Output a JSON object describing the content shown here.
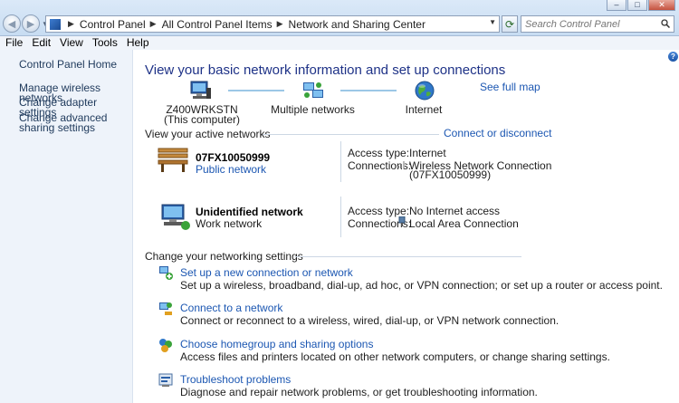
{
  "window": {
    "minimize_glyph": "–",
    "maximize_glyph": "□",
    "close_glyph": "✕"
  },
  "address": {
    "crumbs": [
      "Control Panel",
      "All Control Panel Items",
      "Network and Sharing Center"
    ],
    "search_placeholder": "Search Control Panel"
  },
  "menu": [
    "File",
    "Edit",
    "View",
    "Tools",
    "Help"
  ],
  "sidebar": {
    "home": "Control Panel Home",
    "links": [
      "Manage wireless networks",
      "Change adapter settings",
      "Change advanced sharing settings"
    ]
  },
  "main": {
    "title": "View your basic network information and set up connections",
    "see_full_map": "See full map",
    "map": {
      "computer_name": "Z400WRKSTN",
      "computer_sub": "(This computer)",
      "middle": "Multiple networks",
      "internet": "Internet"
    },
    "active_label": "View your active networks",
    "connect_link": "Connect or disconnect",
    "networks": [
      {
        "name": "07FX10050999",
        "type": "Public network",
        "access_label": "Access type:",
        "access_value": "Internet",
        "conn_label": "Connections:",
        "conn_line1": "Wireless Network Connection",
        "conn_line2": "(07FX10050999)"
      },
      {
        "name": "Unidentified network",
        "type": "Work network",
        "access_label": "Access type:",
        "access_value": "No Internet access",
        "conn_label": "Connections:",
        "conn_line1": "Local Area Connection"
      }
    ],
    "change_label": "Change your networking settings",
    "tasks": [
      {
        "title": "Set up a new connection or network",
        "desc": "Set up a wireless, broadband, dial-up, ad hoc, or VPN connection; or set up a router or access point."
      },
      {
        "title": "Connect to a network",
        "desc": "Connect or reconnect to a wireless, wired, dial-up, or VPN network connection."
      },
      {
        "title": "Choose homegroup and sharing options",
        "desc": "Access files and printers located on other network computers, or change sharing settings."
      },
      {
        "title": "Troubleshoot problems",
        "desc": "Diagnose and repair network problems, or get troubleshooting information."
      }
    ],
    "help_glyph": "?"
  },
  "colors": {
    "link": "#1c57b2",
    "title": "#1e3287",
    "sidebar_bg": "#eef3fa"
  }
}
